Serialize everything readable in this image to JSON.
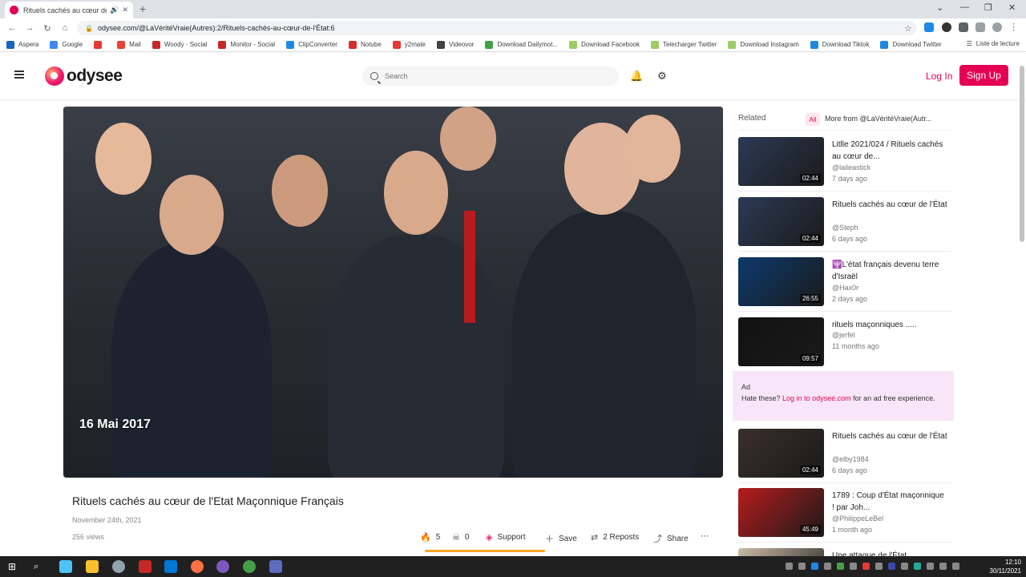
{
  "browser": {
    "tab_title": "Rituels cachés au cœur de l'É",
    "url": "odysee.com/@LaVéritéVraie(Autres):2/Rituels-cachés-au-cœur-de-l'État:6",
    "new_tab": "+",
    "bookmarks": [
      {
        "label": "Aspera",
        "color": "#1565c0"
      },
      {
        "label": "Google",
        "color": "#4285f4"
      },
      {
        "label": "",
        "color": "#e53935"
      },
      {
        "label": "Mail",
        "color": "#ea4335"
      },
      {
        "label": "Woody - Social",
        "color": "#c62828"
      },
      {
        "label": "Monitor - Social",
        "color": "#c62828"
      },
      {
        "label": "ClipConverter",
        "color": "#1e88e5"
      },
      {
        "label": "Notube",
        "color": "#d32f2f"
      },
      {
        "label": "y2mate",
        "color": "#e53935"
      },
      {
        "label": "Videovor",
        "color": "#424242"
      },
      {
        "label": "Download Dailymot...",
        "color": "#43a047"
      },
      {
        "label": "Download Facebook",
        "color": "#9ccc65"
      },
      {
        "label": "Telecharger Twitter",
        "color": "#9ccc65"
      },
      {
        "label": "Download Instagram",
        "color": "#9ccc65"
      },
      {
        "label": "Download Tiktok",
        "color": "#1e88e5"
      },
      {
        "label": "Download Twitter",
        "color": "#1e88e5"
      }
    ],
    "reading_list": "Liste de lecture"
  },
  "header": {
    "logo_text": "odysee",
    "search_placeholder": "Search",
    "login": "Log In",
    "signup": "Sign Up"
  },
  "video": {
    "overlay_date": "16 Mai 2017",
    "title": "Rituels cachés au cœur de l'Etat Maçonnique Français",
    "published": "November 24th, 2021",
    "views": "256 views",
    "likes": "5",
    "dislikes": "0",
    "support": "Support",
    "save": "Save",
    "reposts": "2 Reposts",
    "share": "Share",
    "more": "⋯"
  },
  "related": {
    "header": "Related",
    "all": "All",
    "more_from": "More from @LaVéritéVraie(Autr...",
    "items": [
      {
        "title": "Litlle 2021/024 / Rituels cachés au cœur de...",
        "channel": "@laileastick",
        "time": "7 days ago",
        "duration": "02:44",
        "thumb": "#2c3a55"
      },
      {
        "title": "Rituels cachés au cœur de l'État",
        "channel": "@Steph",
        "time": "6 days ago",
        "duration": "02:44",
        "thumb": "#2c3a55"
      },
      {
        "title": "🕎L'état français devenu terre d'Israël",
        "channel": "@Hax0r",
        "time": "2 days ago",
        "duration": "26:55",
        "thumb": "#0d3a6e"
      },
      {
        "title": "rituels maçonniques .....",
        "channel": "@jerfel",
        "time": "11 months ago",
        "duration": "09:57",
        "thumb": "#111111"
      },
      {
        "title": "Rituels cachés au cœur de l'État",
        "channel": "@elby1984",
        "time": "6 days ago",
        "duration": "02:44",
        "thumb": "#3a2f2a"
      },
      {
        "title": "1789 : Coup d'État maçonnique ! par Joh...",
        "channel": "@PhilippeLeBel",
        "time": "1 month ago",
        "duration": "45:49",
        "thumb": "#b71c1c"
      },
      {
        "title": "Une attaque de l'État",
        "channel": "",
        "time": "",
        "duration": "",
        "thumb": "#ccbba8"
      }
    ],
    "ad": {
      "label": "Ad",
      "text_before": "Hate these? ",
      "link": "Log in to odysee.com",
      "text_after": " for an ad free experience."
    }
  },
  "taskbar": {
    "time": "12:10",
    "date": "30/11/2021"
  }
}
